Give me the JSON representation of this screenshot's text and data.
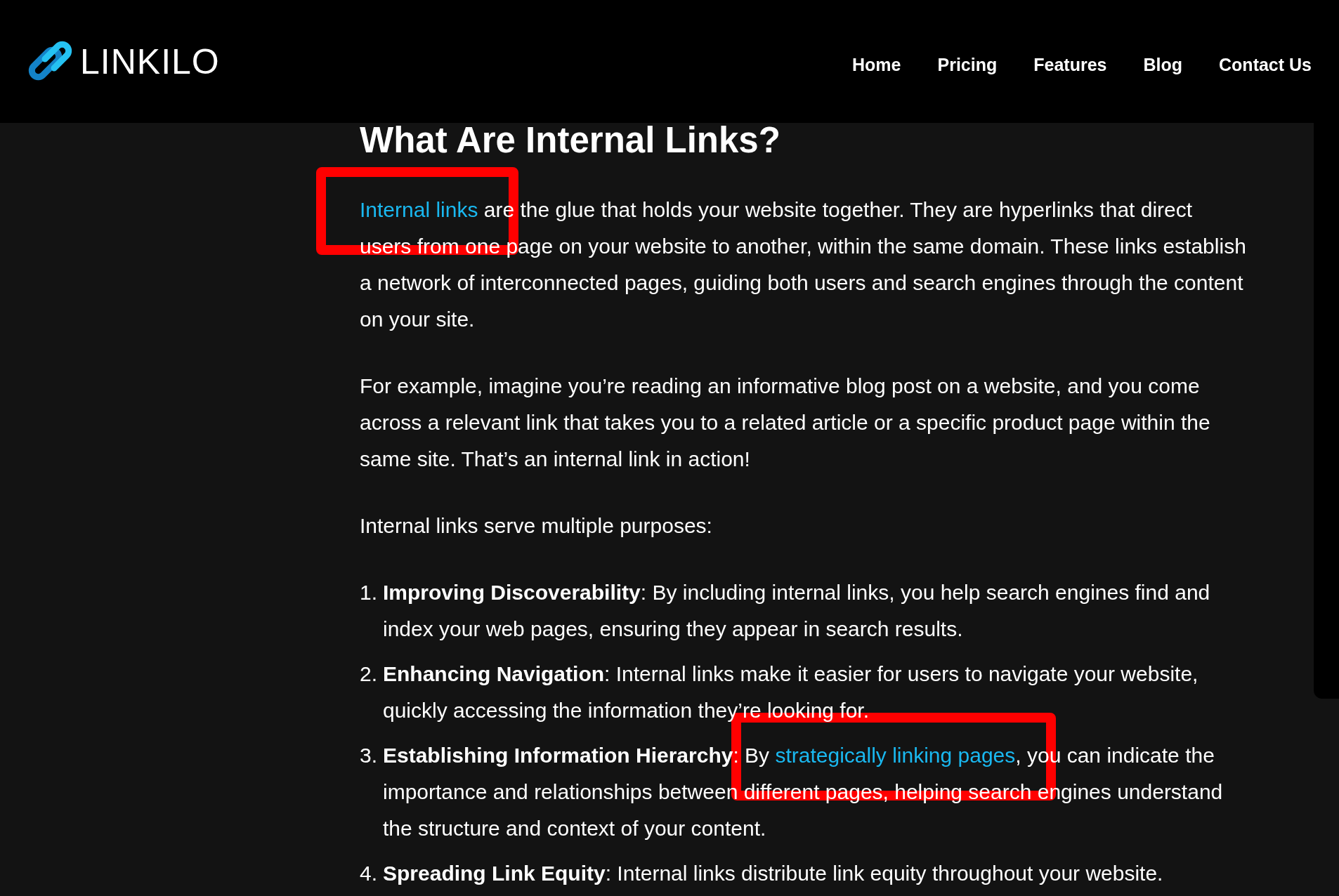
{
  "header": {
    "logo_text": "LINKILO",
    "nav": [
      {
        "label": "Home"
      },
      {
        "label": "Pricing"
      },
      {
        "label": "Features"
      },
      {
        "label": "Blog"
      },
      {
        "label": "Contact Us"
      }
    ]
  },
  "article": {
    "heading": "What Are Internal Links?",
    "blocks": [
      {
        "kind": "paragraph",
        "segments": [
          {
            "kind": "link",
            "text": "Internal links",
            "highlighted": true
          },
          {
            "kind": "plain",
            "text": " are the glue that holds your website together. They are hyperlinks that direct users from one page on your website to another, within the same domain. These links establish a network of interconnected pages, guiding both users and search engines through the content on your site."
          }
        ]
      },
      {
        "kind": "paragraph",
        "segments": [
          {
            "kind": "plain",
            "text": "For example, imagine you’re reading an informative blog post on a website, and you come across a relevant link that takes you to a related article or a specific product page within the same site. That’s an internal link in action!"
          }
        ]
      },
      {
        "kind": "paragraph",
        "segments": [
          {
            "kind": "plain",
            "text": "Internal links serve multiple purposes:"
          }
        ]
      },
      {
        "kind": "list_item",
        "number": "1.",
        "segments": [
          {
            "kind": "bold",
            "text": "Improving Discoverability"
          },
          {
            "kind": "plain",
            "text": ": By including internal links, you help search engines find and index your web pages, ensuring they appear in search results."
          }
        ]
      },
      {
        "kind": "list_item",
        "number": "2.",
        "segments": [
          {
            "kind": "bold",
            "text": "Enhancing Navigation"
          },
          {
            "kind": "plain",
            "text": ": Internal links make it easier for users to navigate your website, quickly accessing the information they’re looking for."
          }
        ]
      },
      {
        "kind": "list_item",
        "number": "3.",
        "segments": [
          {
            "kind": "bold",
            "text": "Establishing Information Hierarchy"
          },
          {
            "kind": "plain",
            "text": ": By "
          },
          {
            "kind": "link",
            "text": "strategically linking pages",
            "highlighted": true
          },
          {
            "kind": "plain",
            "text": ", you can indicate the importance and relationships between different pages, helping search engines understand the structure and context of your content."
          }
        ]
      },
      {
        "kind": "list_item",
        "number": "4.",
        "segments": [
          {
            "kind": "bold",
            "text": "Spreading Link Equity"
          },
          {
            "kind": "plain",
            "text": ": Internal links distribute link equity throughout your website."
          }
        ]
      }
    ]
  }
}
